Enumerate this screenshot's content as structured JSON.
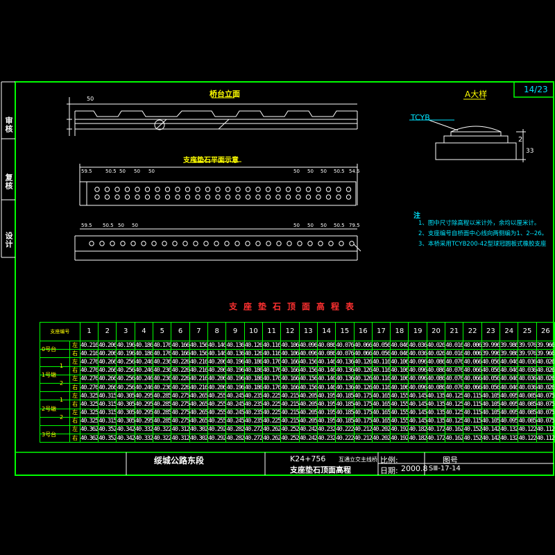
{
  "sheet": {
    "page_number": "14/23",
    "side_labels": [
      "审核",
      "复核",
      "设计"
    ]
  },
  "elevation_drawing": {
    "title": "桥台立面",
    "dims": [
      "50"
    ]
  },
  "support_plan": {
    "title": "支座垫石平面示意",
    "top_dims_left": [
      "59.5",
      "50.5",
      "50",
      "50",
      "50"
    ],
    "top_dims_right": [
      "50",
      "50",
      "50",
      "50.5",
      "54.5"
    ],
    "bottom_dims_left": [
      "59.5",
      "50.5",
      "50",
      "50"
    ],
    "bottom_dims_right": [
      "50",
      "50",
      "50",
      "50.5",
      "79.5"
    ]
  },
  "detail_a": {
    "title": "A大样",
    "bearing_label": "TCYB",
    "dims": [
      "2",
      "33"
    ]
  },
  "notes": {
    "heading": "注",
    "items": [
      "1、图中尺寸除高程以米计外，余均以厘米计。",
      "2、支座编号自桥面中心线向两侧编为1、2--26。",
      "3、本桥采用TCYB200-42型球冠圆板式橡胶支座"
    ]
  },
  "table": {
    "title": "支座垫石顶面高程表",
    "corner": "支座编号",
    "columns": [
      "1",
      "2",
      "3",
      "4",
      "5",
      "6",
      "7",
      "8",
      "9",
      "10",
      "11",
      "12",
      "13",
      "14",
      "15",
      "16",
      "17",
      "18",
      "19",
      "20",
      "21",
      "22",
      "23",
      "24",
      "25",
      "26"
    ],
    "rows": [
      {
        "values": [
          "40.216",
          "40.206",
          "40.196",
          "40.186",
          "40.176",
          "40.166",
          "40.156",
          "40.146",
          "40.136",
          "40.126",
          "40.116",
          "40.106",
          "40.096",
          "40.086",
          "40.076",
          "40.066",
          "40.056",
          "40.046",
          "40.036",
          "40.026",
          "40.016",
          "40.006",
          "39.996",
          "39.986",
          "39.976",
          "39.966"
        ]
      },
      {
        "values": [
          "40.216",
          "40.206",
          "40.196",
          "40.186",
          "40.176",
          "40.166",
          "40.156",
          "40.146",
          "40.136",
          "40.126",
          "40.116",
          "40.106",
          "40.096",
          "40.086",
          "40.076",
          "40.066",
          "40.056",
          "40.046",
          "40.036",
          "40.026",
          "40.016",
          "40.006",
          "39.996",
          "39.986",
          "39.976",
          "39.966"
        ]
      },
      {
        "values": [
          "40.276",
          "40.266",
          "40.256",
          "40.246",
          "40.236",
          "40.226",
          "40.216",
          "40.206",
          "40.196",
          "40.186",
          "40.176",
          "40.166",
          "40.156",
          "40.146",
          "40.136",
          "40.126",
          "40.116",
          "40.106",
          "40.096",
          "40.086",
          "40.076",
          "40.066",
          "40.056",
          "40.046",
          "40.036",
          "40.026"
        ]
      },
      {
        "values": [
          "40.276",
          "40.266",
          "40.256",
          "40.246",
          "40.236",
          "40.226",
          "40.216",
          "40.206",
          "40.196",
          "40.186",
          "40.176",
          "40.166",
          "40.156",
          "40.146",
          "40.136",
          "40.126",
          "40.116",
          "40.106",
          "40.096",
          "40.086",
          "40.076",
          "40.066",
          "40.056",
          "40.046",
          "40.036",
          "40.026"
        ]
      },
      {
        "values": [
          "40.276",
          "40.266",
          "40.256",
          "40.246",
          "40.236",
          "40.226",
          "40.216",
          "40.206",
          "40.196",
          "40.186",
          "40.176",
          "40.166",
          "40.156",
          "40.146",
          "40.136",
          "40.126",
          "40.116",
          "40.106",
          "40.096",
          "40.086",
          "40.076",
          "40.066",
          "40.056",
          "40.046",
          "40.036",
          "40.026"
        ]
      },
      {
        "values": [
          "40.276",
          "40.266",
          "40.256",
          "40.246",
          "40.236",
          "40.226",
          "40.216",
          "40.206",
          "40.196",
          "40.186",
          "40.176",
          "40.166",
          "40.156",
          "40.146",
          "40.136",
          "40.126",
          "40.116",
          "40.106",
          "40.096",
          "40.086",
          "40.076",
          "40.066",
          "40.056",
          "40.046",
          "40.036",
          "40.026"
        ]
      },
      {
        "values": [
          "40.325",
          "40.315",
          "40.305",
          "40.295",
          "40.285",
          "40.275",
          "40.265",
          "40.255",
          "40.245",
          "40.235",
          "40.225",
          "40.215",
          "40.205",
          "40.195",
          "40.185",
          "40.175",
          "40.165",
          "40.155",
          "40.145",
          "40.135",
          "40.125",
          "40.115",
          "40.105",
          "40.095",
          "40.085",
          "40.075"
        ]
      },
      {
        "values": [
          "40.325",
          "40.315",
          "40.305",
          "40.295",
          "40.285",
          "40.275",
          "40.265",
          "40.255",
          "40.245",
          "40.235",
          "40.225",
          "40.215",
          "40.205",
          "40.195",
          "40.185",
          "40.175",
          "40.165",
          "40.155",
          "40.145",
          "40.135",
          "40.125",
          "40.115",
          "40.105",
          "40.095",
          "40.085",
          "40.075"
        ]
      },
      {
        "values": [
          "40.325",
          "40.315",
          "40.305",
          "40.295",
          "40.285",
          "40.275",
          "40.265",
          "40.255",
          "40.245",
          "40.235",
          "40.225",
          "40.215",
          "40.205",
          "40.195",
          "40.185",
          "40.175",
          "40.165",
          "40.155",
          "40.145",
          "40.135",
          "40.125",
          "40.115",
          "40.105",
          "40.095",
          "40.085",
          "40.075"
        ]
      },
      {
        "values": [
          "40.325",
          "40.315",
          "40.305",
          "40.295",
          "40.285",
          "40.275",
          "40.265",
          "40.255",
          "40.245",
          "40.235",
          "40.225",
          "40.215",
          "40.205",
          "40.195",
          "40.185",
          "40.175",
          "40.165",
          "40.155",
          "40.145",
          "40.135",
          "40.125",
          "40.115",
          "40.105",
          "40.095",
          "40.085",
          "40.075"
        ]
      },
      {
        "values": [
          "40.362",
          "40.352",
          "40.342",
          "40.332",
          "40.322",
          "40.312",
          "40.302",
          "40.292",
          "40.282",
          "40.272",
          "40.262",
          "40.252",
          "40.242",
          "40.232",
          "40.222",
          "40.212",
          "40.202",
          "40.192",
          "40.182",
          "40.172",
          "40.162",
          "40.152",
          "40.142",
          "40.132",
          "40.122",
          "40.112"
        ]
      },
      {
        "values": [
          "40.362",
          "40.352",
          "40.342",
          "40.332",
          "40.322",
          "40.312",
          "40.302",
          "40.292",
          "40.282",
          "40.272",
          "40.262",
          "40.252",
          "40.242",
          "40.232",
          "40.222",
          "40.212",
          "40.202",
          "40.192",
          "40.182",
          "40.172",
          "40.162",
          "40.152",
          "40.142",
          "40.132",
          "40.122",
          "40.112"
        ]
      }
    ],
    "groups": [
      "0号台",
      "1号墩",
      "2号墩",
      "3号台"
    ],
    "subgroups": [
      "1",
      "2",
      "1",
      "2"
    ],
    "row_labels": [
      "左",
      "右",
      "左",
      "右",
      "左",
      "右",
      "左",
      "右",
      "左",
      "右",
      "左",
      "右"
    ]
  },
  "title_block": {
    "project": "绥城公路东段",
    "station": "K24+756",
    "bridge": "互通立交主线桥",
    "drawing_title": "支座垫石顶面高程",
    "scale_label": "比例:",
    "date_label": "日期:",
    "date_value": "2000.8",
    "figno_label": "图号",
    "figno_value": "SⅢ-17-14"
  },
  "colors": {
    "frame": "#00ff00",
    "lines": "#ffffff",
    "notes": "#00e5ff",
    "titles": "#ffff00",
    "table_title": "#ff3030"
  }
}
